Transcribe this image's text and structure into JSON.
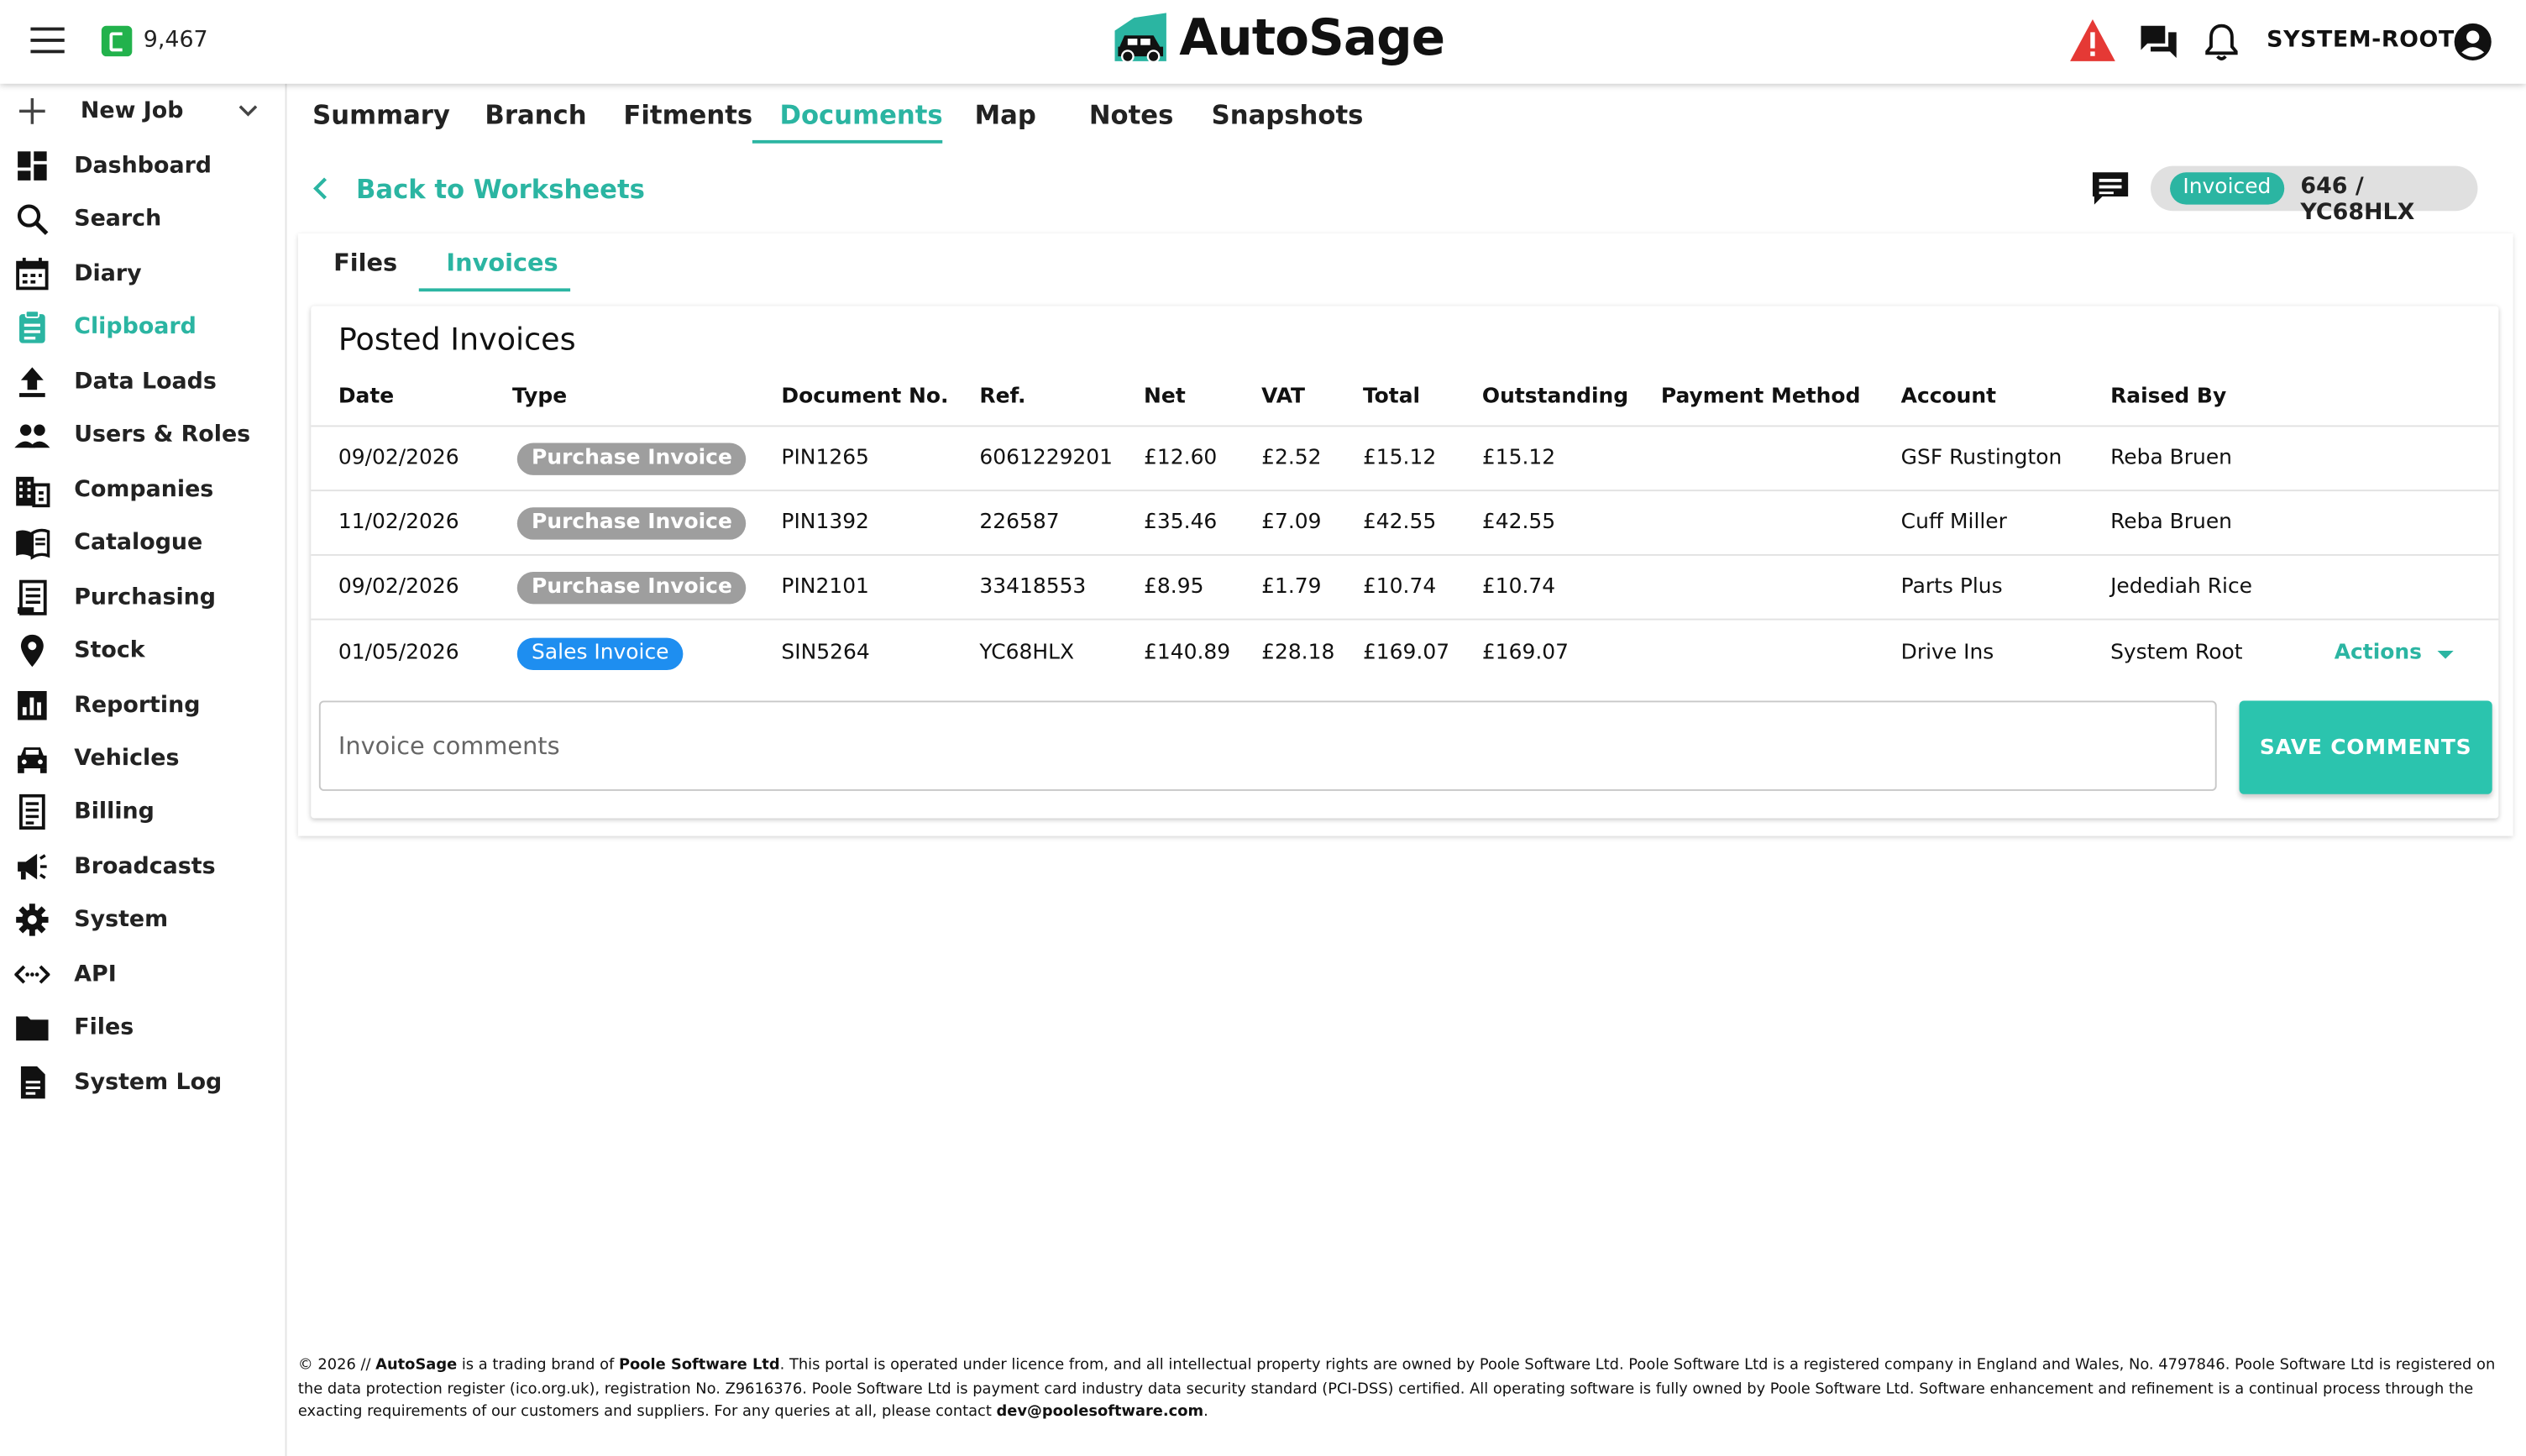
{
  "header": {
    "credits": "9,467",
    "brand": "AutoSage",
    "user": "SYSTEM-ROOT",
    "colors": {
      "accent": "#2bb5a2",
      "credit": "#22b24c",
      "alert": "#e53935",
      "sales_badge": "#1e8ef0",
      "purchase_badge": "#9e9e9e"
    },
    "icons": [
      "menu-icon",
      "credit-icon",
      "alert-warning-icon",
      "messages-icon",
      "notifications-bell-icon",
      "account-circle-icon"
    ]
  },
  "sidebar": {
    "new_job": "New Job",
    "items": [
      {
        "label": "Dashboard",
        "icon": "dashboard-icon"
      },
      {
        "label": "Search",
        "icon": "search-icon"
      },
      {
        "label": "Diary",
        "icon": "calendar-icon"
      },
      {
        "label": "Clipboard",
        "icon": "clipboard-icon",
        "active": true
      },
      {
        "label": "Data Loads",
        "icon": "upload-icon"
      },
      {
        "label": "Users & Roles",
        "icon": "users-icon"
      },
      {
        "label": "Companies",
        "icon": "building-icon"
      },
      {
        "label": "Catalogue",
        "icon": "book-icon"
      },
      {
        "label": "Purchasing",
        "icon": "receipt-icon"
      },
      {
        "label": "Stock",
        "icon": "location-pin-icon"
      },
      {
        "label": "Reporting",
        "icon": "chart-icon"
      },
      {
        "label": "Vehicles",
        "icon": "car-icon"
      },
      {
        "label": "Billing",
        "icon": "billing-icon"
      },
      {
        "label": "Broadcasts",
        "icon": "megaphone-icon"
      },
      {
        "label": "System",
        "icon": "gear-icon"
      },
      {
        "label": "API",
        "icon": "api-icon"
      },
      {
        "label": "Files",
        "icon": "folder-icon"
      },
      {
        "label": "System Log",
        "icon": "document-icon"
      }
    ]
  },
  "tabs": [
    "Summary",
    "Branch",
    "Fitments",
    "Documents",
    "Map",
    "Notes",
    "Snapshots"
  ],
  "active_tab": "Documents",
  "back_link": "Back to Worksheets",
  "status": {
    "badge": "Invoiced",
    "job": "646 / YC68HLX"
  },
  "subtabs": [
    "Files",
    "Invoices"
  ],
  "active_subtab": "Invoices",
  "invoices": {
    "title": "Posted Invoices",
    "columns": [
      "Date",
      "Type",
      "Document No.",
      "Ref.",
      "Net",
      "VAT",
      "Total",
      "Outstanding",
      "Payment Method",
      "Account",
      "Raised By"
    ],
    "rows": [
      {
        "date": "09/02/2026",
        "type": "Purchase Invoice",
        "doc": "PIN1265",
        "ref": "6061229201",
        "net": "£12.60",
        "vat": "£2.52",
        "total": "£15.12",
        "outstanding": "£15.12",
        "payment": "",
        "account": "GSF Rustington",
        "raised_by": "Reba Bruen"
      },
      {
        "date": "11/02/2026",
        "type": "Purchase Invoice",
        "doc": "PIN1392",
        "ref": "226587",
        "net": "£35.46",
        "vat": "£7.09",
        "total": "£42.55",
        "outstanding": "£42.55",
        "payment": "",
        "account": "Cuff Miller",
        "raised_by": "Reba Bruen"
      },
      {
        "date": "09/02/2026",
        "type": "Purchase Invoice",
        "doc": "PIN2101",
        "ref": "33418553",
        "net": "£8.95",
        "vat": "£1.79",
        "total": "£10.74",
        "outstanding": "£10.74",
        "payment": "",
        "account": "Parts Plus",
        "raised_by": "Jedediah Rice"
      },
      {
        "date": "01/05/2026",
        "type": "Sales Invoice",
        "doc": "SIN5264",
        "ref": "YC68HLX",
        "net": "£140.89",
        "vat": "£28.18",
        "total": "£169.07",
        "outstanding": "£169.07",
        "payment": "",
        "account": "Drive Ins",
        "raised_by": "System Root",
        "actions": "Actions"
      }
    ],
    "comments_placeholder": "Invoice comments",
    "comments_value": "",
    "save_label": "SAVE COMMENTS"
  },
  "footer": {
    "year_prefix": "© 2026 // ",
    "brand": "AutoSage",
    "text1": " is a trading brand of ",
    "company": "Poole Software Ltd",
    "text2": ". This portal is operated under licence from, and all intellectual property rights are owned by Poole Software Ltd. Poole Software Ltd is a registered company in England and Wales, No. 4797846. Poole Software Ltd is registered on the data protection register (ico.org.uk), registration No. Z9616376. Poole Software Ltd is payment card industry data security standard (PCI-DSS) certified. All operating software is fully owned by Poole Software Ltd. Software enhancement and refinement is a continual process through the exacting requirements of our customers and suppliers. For any queries at all, please contact ",
    "email": "dev@poolesoftware.com",
    "end": "."
  }
}
